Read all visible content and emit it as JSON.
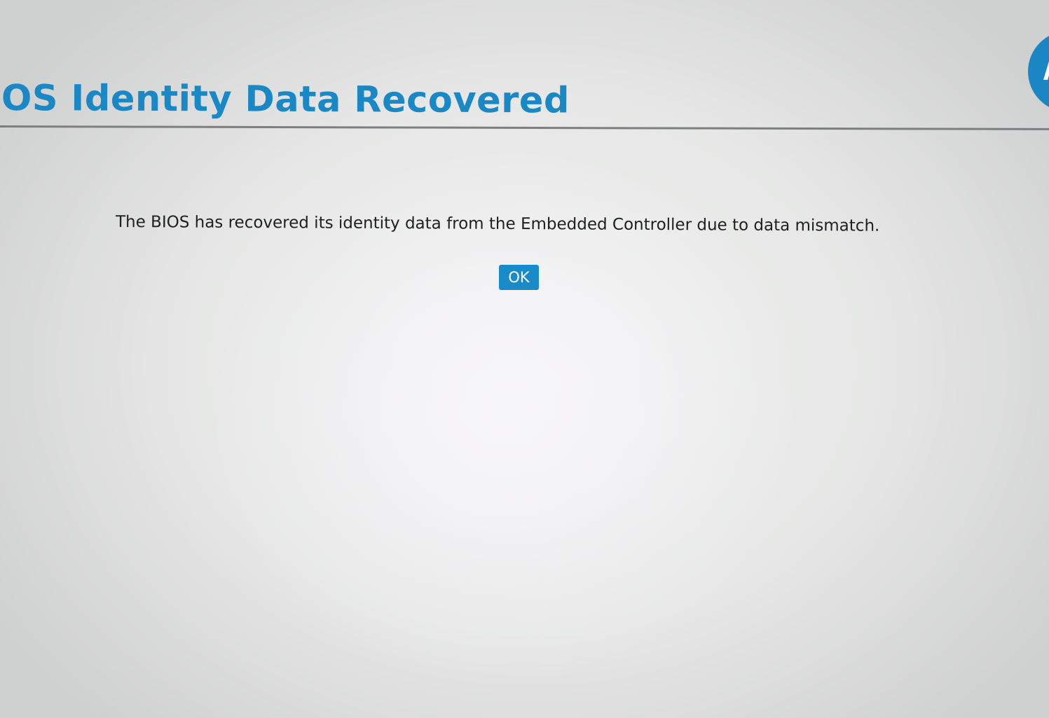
{
  "header": {
    "title": "OS Identity Data Recovered",
    "logo_icon": "hp-logo-icon"
  },
  "dialog": {
    "message": "The BIOS has recovered its identity data from the Embedded Controller due to data mismatch.",
    "ok_label": "OK"
  },
  "colors": {
    "accent": "#1a8bc9",
    "title": "#1b88c6",
    "text": "#1d1f21",
    "background": "#e8e9e8",
    "rule": "#7c7f82"
  }
}
